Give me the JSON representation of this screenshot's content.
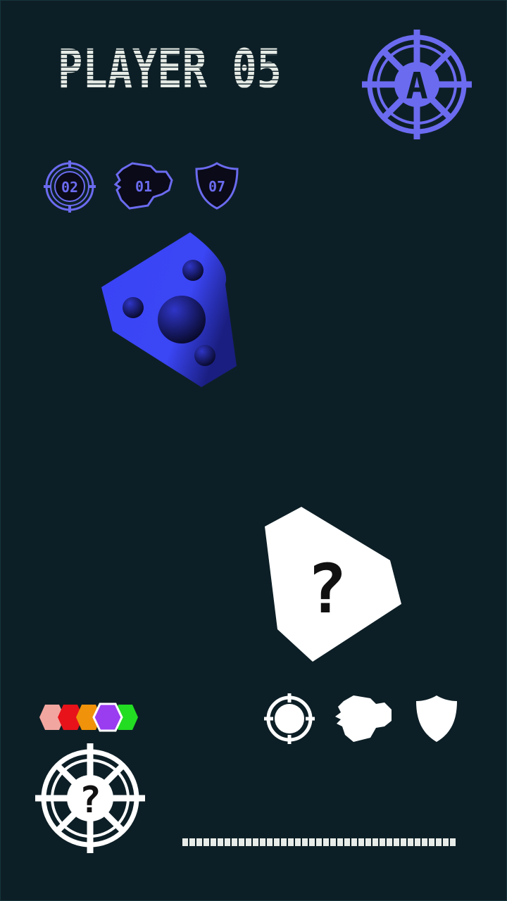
{
  "player": {
    "label": "PLAYER 05"
  },
  "rank_badge": {
    "letter": "A",
    "icon": "crosshair-wheel-icon"
  },
  "stats": [
    {
      "icon": "crosshair-icon",
      "value": "02"
    },
    {
      "icon": "fist-icon",
      "value": "01"
    },
    {
      "icon": "shield-icon",
      "value": "07"
    }
  ],
  "selected_piece": {
    "icon": "blue-dice-piece"
  },
  "unknown_piece": {
    "symbol": "?"
  },
  "color_picker": {
    "colors": [
      "#f2a6a0",
      "#e8121a",
      "#f0920a",
      "#9a3cf0",
      "#22dd22"
    ],
    "selected_index": 3
  },
  "action_icons": [
    {
      "icon": "crosshair-icon"
    },
    {
      "icon": "fist-icon"
    },
    {
      "icon": "shield-icon"
    }
  ],
  "unknown_badge": {
    "symbol": "?",
    "icon": "crosshair-wheel-icon"
  },
  "progress": {
    "segments": 39
  },
  "colors": {
    "background": "#0d1f26",
    "accent": "#6b6bf0",
    "piece_blue": "#3b46f5",
    "white": "#ffffff",
    "title": "#e6ebe6"
  }
}
